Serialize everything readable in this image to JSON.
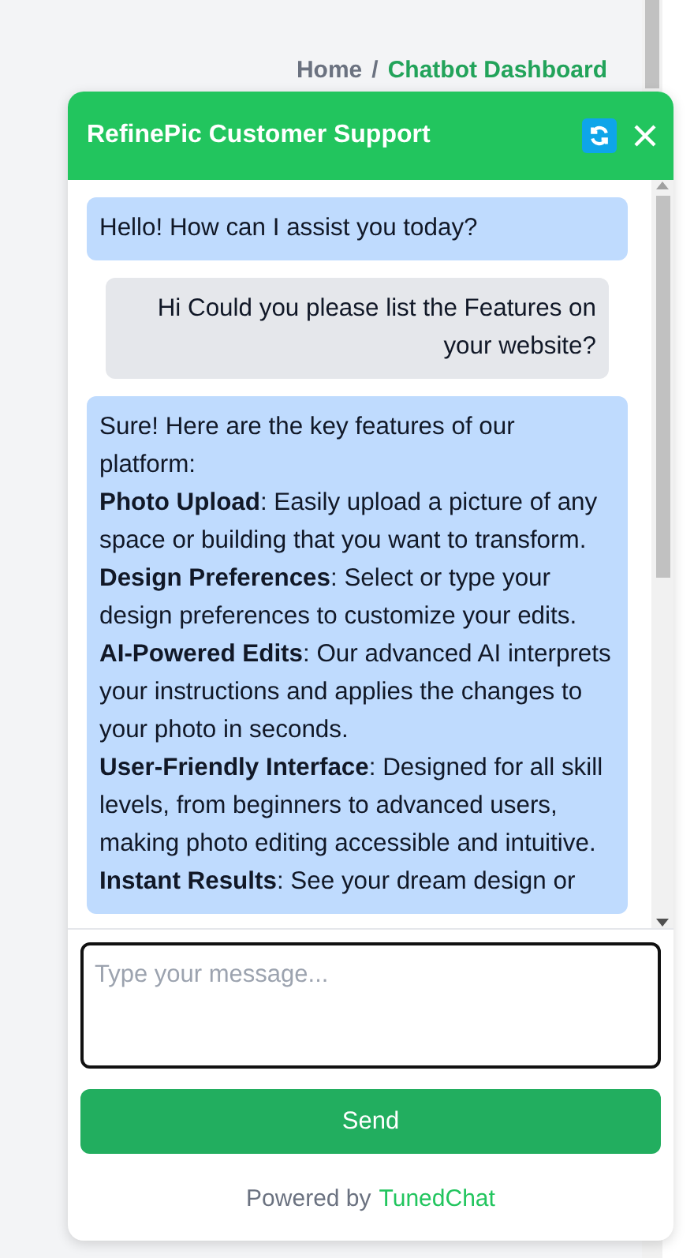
{
  "breadcrumb": {
    "items": [
      {
        "label": "Home",
        "selected": false
      },
      {
        "label": "Chatbot Dashboard",
        "selected": true
      }
    ],
    "separator": "/"
  },
  "chat": {
    "title": "RefinePic Customer Support",
    "messages": [
      {
        "kind": "bot",
        "lines": [
          "Hello! How can I assist you today?"
        ]
      },
      {
        "kind": "user",
        "lines": [
          "Hi Could you please list the Features on your website?"
        ]
      },
      {
        "kind": "bot",
        "lines": [
          "Sure! Here are the key features of our platform:",
          "**Photo Upload**: Easily upload a picture of any space or building that you want to transform.",
          "**Design Preferences**: Select or type your design preferences to customize your edits.",
          "**AI-Powered Edits**: Our advanced AI interprets your instructions and applies the changes to your photo in seconds.",
          "**User-Friendly Interface**: Designed for all skill levels, from beginners to advanced users, making photo editing accessible and intuitive.",
          "**Instant Results**: See your dream design or"
        ]
      }
    ],
    "input": {
      "placeholder": "Type your message..."
    },
    "send_button": "Send",
    "footer": {
      "prefix": "Powered by",
      "brand": "TunedChat"
    }
  }
}
